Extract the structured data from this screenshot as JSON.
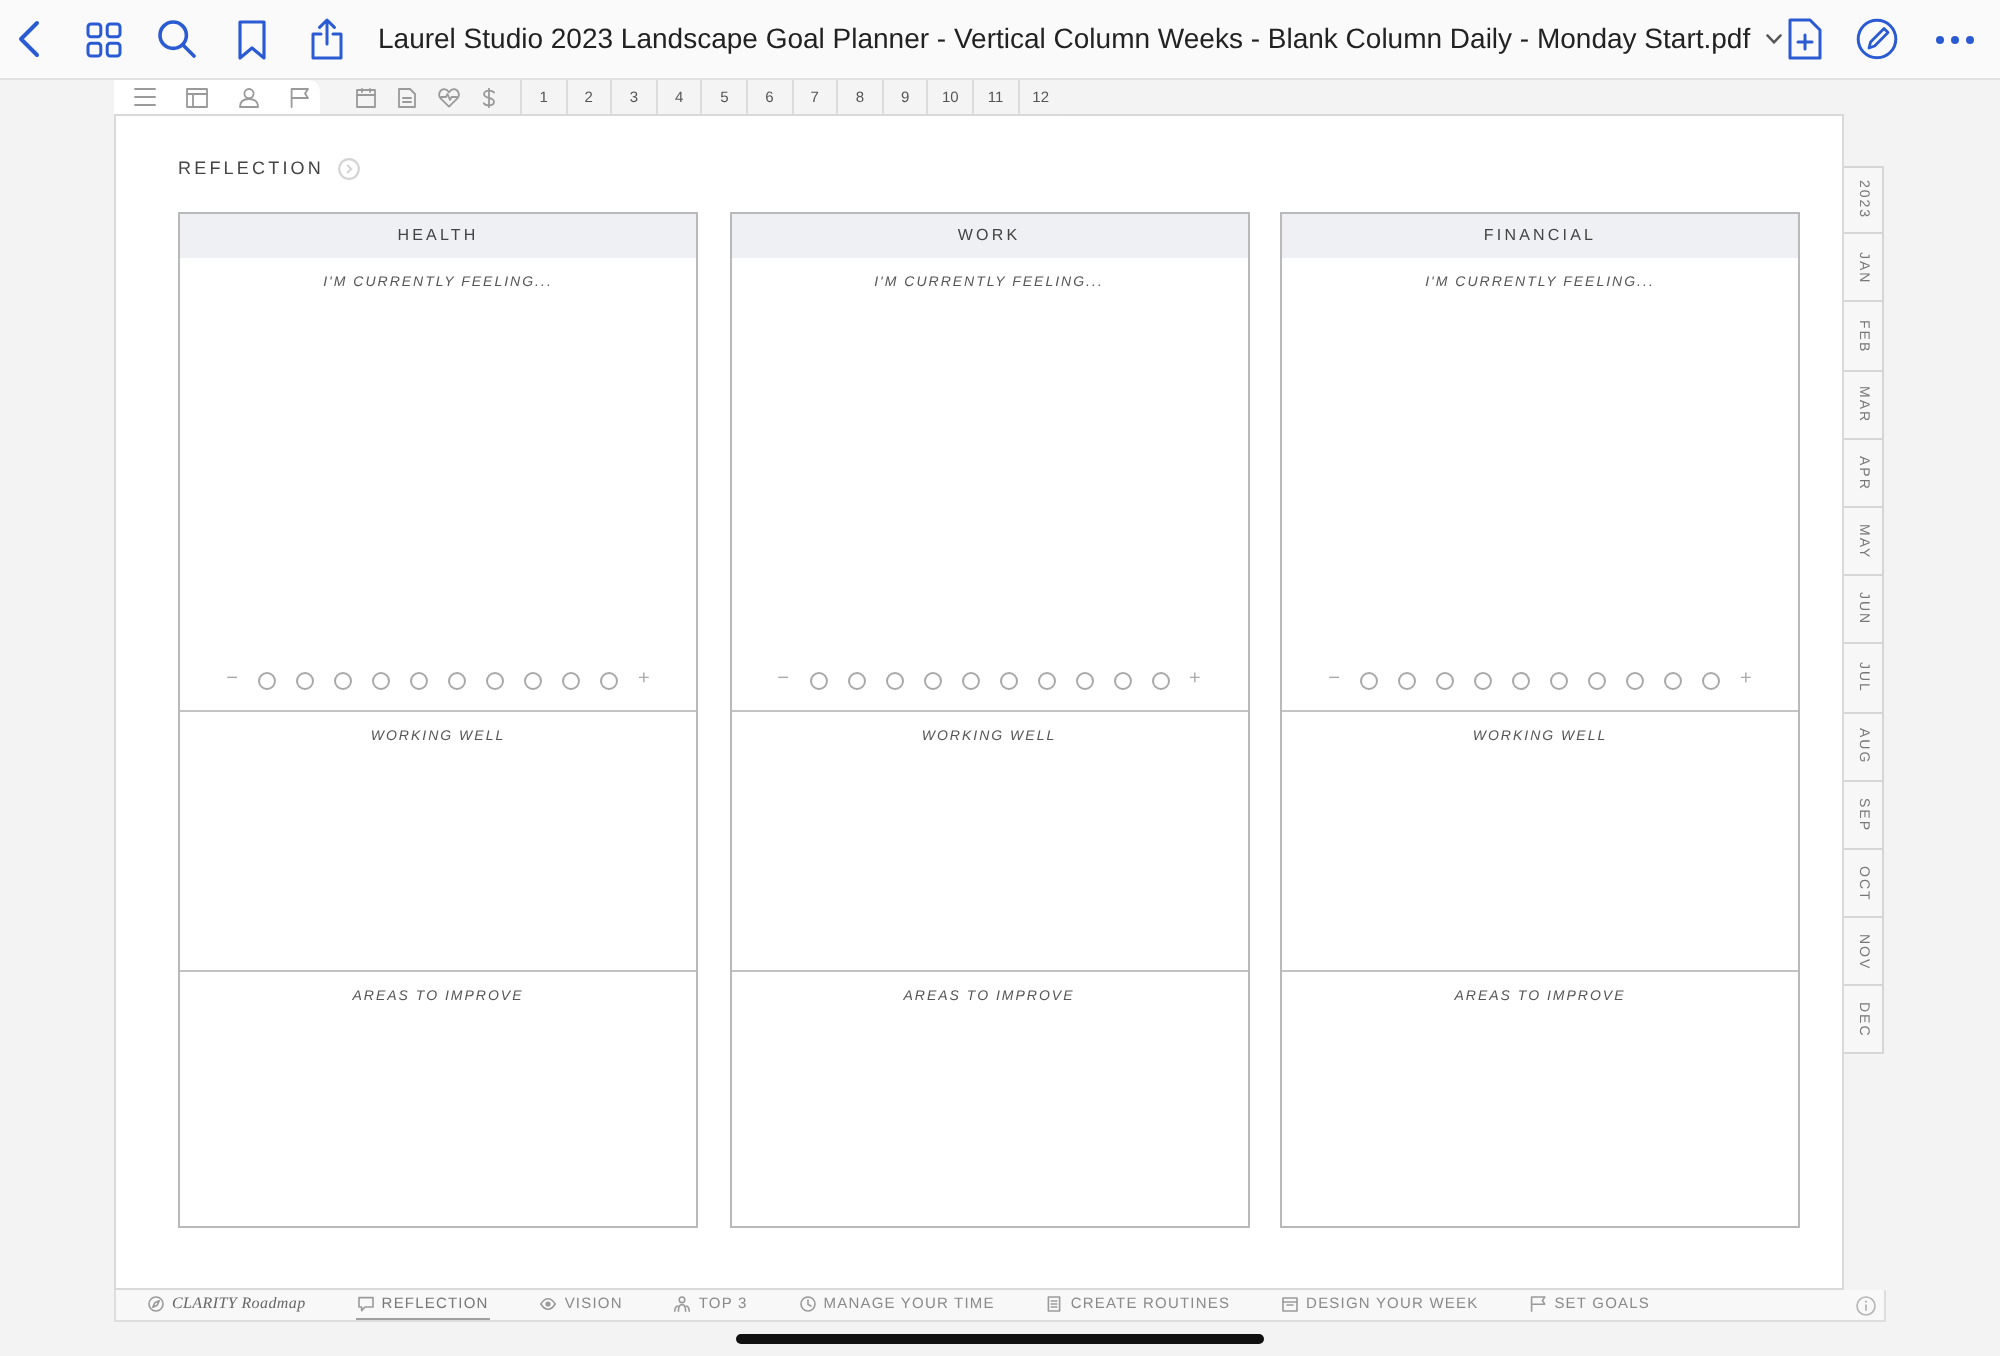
{
  "app_bar": {
    "title": "Laurel Studio 2023 Landscape Goal Planner - Vertical Column Weeks - Blank Column Daily - Monday Start.pdf"
  },
  "top_tabs": [
    "1",
    "2",
    "3",
    "4",
    "5",
    "6",
    "7",
    "8",
    "9",
    "10",
    "11",
    "12"
  ],
  "section_title": "REFLECTION",
  "cards": [
    {
      "title": "HEALTH",
      "feeling_label": "I'M CURRENTLY FEELING...",
      "scale": {
        "low": "−",
        "high": "+",
        "points": [
          {
            "selected": false
          },
          {
            "selected": false
          },
          {
            "selected": false
          },
          {
            "selected": false
          },
          {
            "selected": false
          },
          {
            "selected": false
          },
          {
            "selected": false
          },
          {
            "selected": false
          },
          {
            "selected": false
          },
          {
            "selected": false
          }
        ]
      },
      "note_labels": [
        "WORKING WELL",
        "AREAS TO IMPROVE"
      ]
    },
    {
      "title": "WORK",
      "feeling_label": "I'M CURRENTLY FEELING...",
      "scale": {
        "low": "−",
        "high": "+",
        "points": [
          {
            "selected": false
          },
          {
            "selected": false
          },
          {
            "selected": false
          },
          {
            "selected": false
          },
          {
            "selected": false
          },
          {
            "selected": false
          },
          {
            "selected": false
          },
          {
            "selected": false
          },
          {
            "selected": false
          },
          {
            "selected": false
          }
        ]
      },
      "note_labels": [
        "WORKING WELL",
        "AREAS TO IMPROVE"
      ]
    },
    {
      "title": "FINANCIAL",
      "feeling_label": "I'M CURRENTLY FEELING...",
      "scale": {
        "low": "−",
        "high": "+",
        "points": [
          {
            "selected": false
          },
          {
            "selected": false
          },
          {
            "selected": false
          },
          {
            "selected": false
          },
          {
            "selected": false
          },
          {
            "selected": false
          },
          {
            "selected": false
          },
          {
            "selected": false
          },
          {
            "selected": false
          },
          {
            "selected": false
          }
        ]
      },
      "note_labels": [
        "WORKING WELL",
        "AREAS TO IMPROVE"
      ]
    }
  ],
  "side_tabs": [
    "2023",
    "JAN",
    "FEB",
    "MAR",
    "APR",
    "MAY",
    "JUN",
    "JUL",
    "AUG",
    "SEP",
    "OCT",
    "NOV",
    "DEC"
  ],
  "bottom_nav": [
    {
      "kind": "brand",
      "label": "CLARITY Roadmap",
      "selected": false
    },
    {
      "kind": "section",
      "label": "REFLECTION",
      "selected": true
    },
    {
      "kind": "section",
      "label": "VISION",
      "selected": false
    },
    {
      "kind": "section",
      "label": "TOP 3",
      "selected": false
    },
    {
      "kind": "section",
      "label": "MANAGE YOUR TIME",
      "selected": false
    },
    {
      "kind": "section",
      "label": "CREATE ROUTINES",
      "selected": false
    },
    {
      "kind": "section",
      "label": "DESIGN YOUR WEEK",
      "selected": false
    },
    {
      "kind": "section",
      "label": "SET GOALS",
      "selected": false
    }
  ]
}
